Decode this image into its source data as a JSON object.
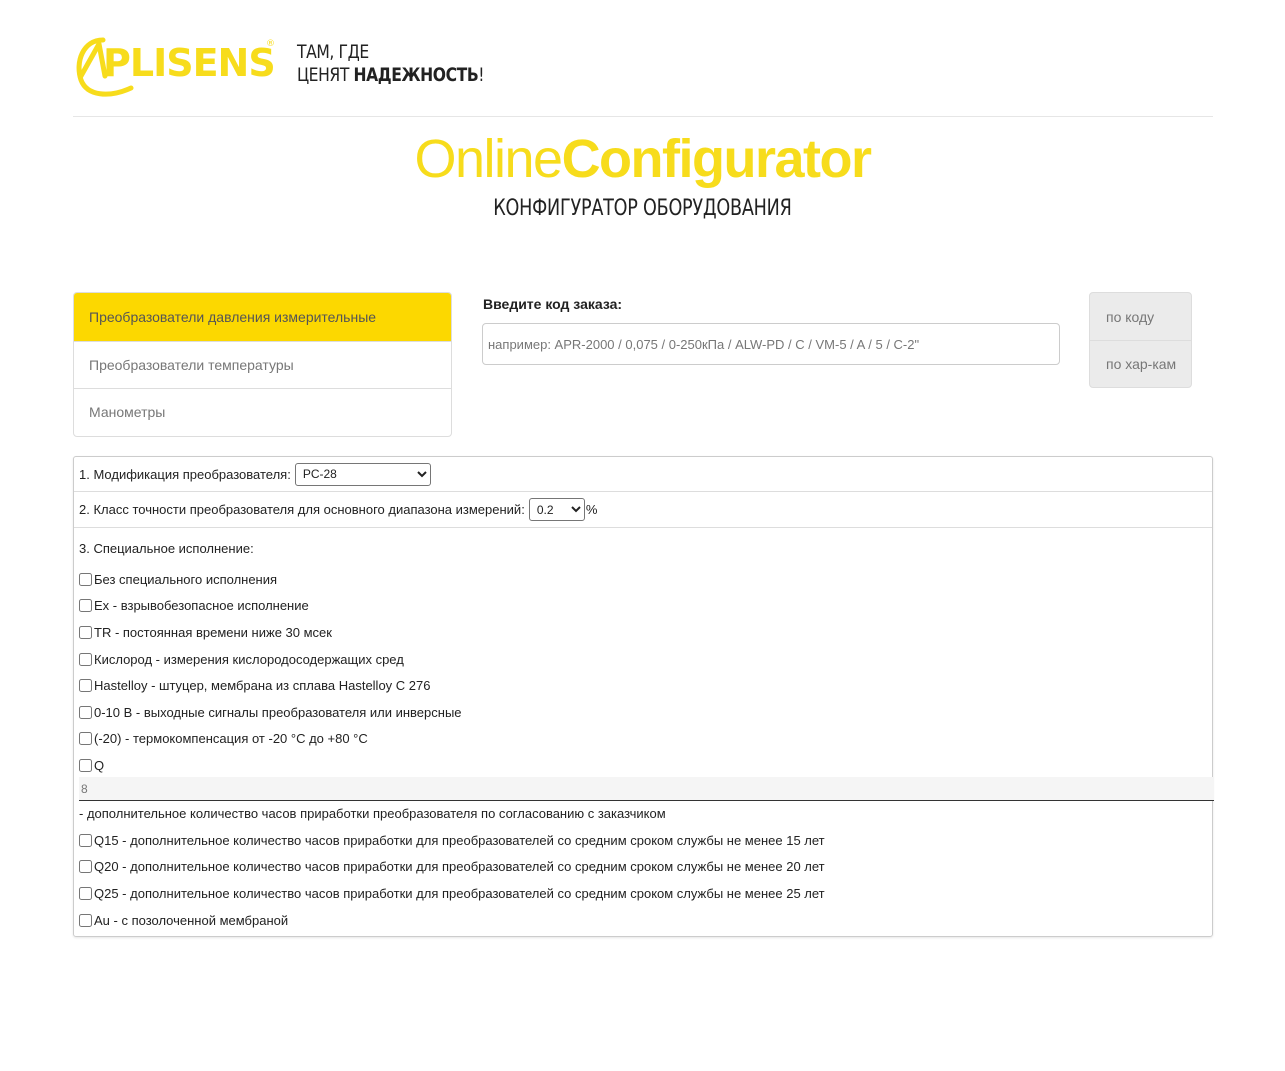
{
  "brand": {
    "logo_text": "APLISENS",
    "tagline_line1": "ТАМ, ГДЕ",
    "tagline_line2_normal": "ЦЕНЯТ ",
    "tagline_line2_bold": "НАДЕЖНОСТЬ",
    "tagline_line2_end": "!",
    "color": "#f7dc1c"
  },
  "hero": {
    "title_light": "Online",
    "title_bold": "Configurator",
    "subtitle": "КОНФИГУРАТОР ОБОРУДОВАНИЯ"
  },
  "categories": [
    {
      "label": "Преобразователи давления измерительные",
      "active": true
    },
    {
      "label": "Преобразователи температуры",
      "active": false
    },
    {
      "label": "Манометры",
      "active": false
    }
  ],
  "order_code": {
    "label": "Введите код заказа:",
    "placeholder": "например: APR-2000 / 0,075 / 0-250кПа / ALW-PD / C / VM-5 / A / 5 / C-2\""
  },
  "modes": [
    "по коду",
    "по хар-кам"
  ],
  "config": {
    "modification": {
      "label": "1. Модификация преобразователя:",
      "selected": "PC-28"
    },
    "accuracy": {
      "label": "2. Класс точности преобразователя для основного диапазона измерений:",
      "selected": "0.2",
      "unit": "%"
    },
    "special": {
      "title": "3. Специальное исполнение:",
      "options": [
        "Без специального исполнения",
        "Ex - взрывобезопасное исполнение",
        "TR - постоянная времени ниже 30 мсек",
        "Кислород - измерения кислородосодержащих сред",
        "Hastelloy - штуцер, мембрана из сплава Hastelloy C 276",
        "0-10 В - выходные сигналы преобразователя или инверсные",
        "(-20) - термокомпенсация от -20 °C до +80 °C",
        "Q"
      ],
      "q_value": "8",
      "q_description": "- дополнительное количество часов приработки преобразователя по согласованию с заказчиком",
      "options_after": [
        "Q15 - дополнительное количество часов приработки для преобразователей со средним сроком службы не менее 15 лет",
        "Q20 - дополнительное количество часов приработки для преобразователей со средним сроком службы не менее 20 лет",
        "Q25 - дополнительное количество часов приработки для преобразователей со средним сроком службы не менее 25 лет",
        "Au - с позолоченной мембраной"
      ]
    }
  }
}
